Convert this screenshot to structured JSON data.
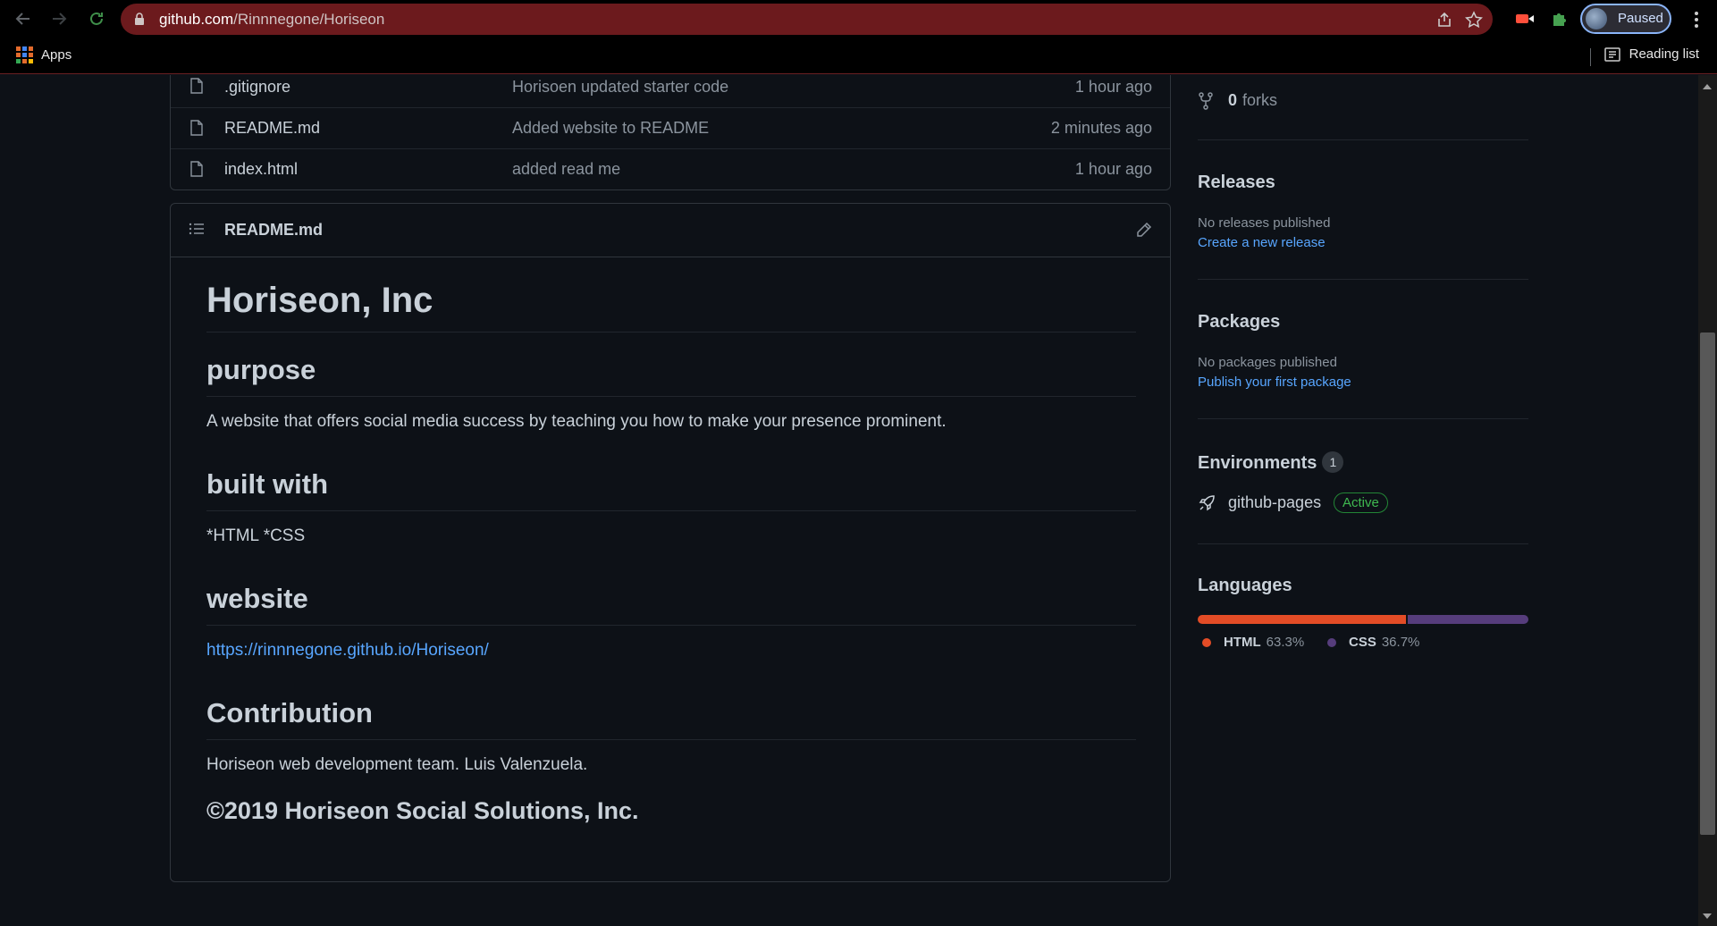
{
  "browser": {
    "url_host": "github.com",
    "url_path": "/Rinnnegone/Horiseon",
    "profile_label": "Paused",
    "apps_label": "Apps",
    "reading_list_label": "Reading list"
  },
  "files": [
    {
      "name": ".gitignore",
      "message": "Horisoen updated starter code",
      "age": "1 hour ago"
    },
    {
      "name": "README.md",
      "message": "Added website to README",
      "age": "2 minutes ago"
    },
    {
      "name": "index.html",
      "message": "added read me",
      "age": "1 hour ago"
    }
  ],
  "readme": {
    "header_title": "README.md",
    "h1": "Horiseon, Inc",
    "sections": {
      "purpose_heading": "purpose",
      "purpose_text": "A website that offers social media success by teaching you how to make your presence prominent.",
      "built_heading": "built with",
      "built_text": "*HTML *CSS",
      "website_heading": "website",
      "website_link": "https://rinnnegone.github.io/Horiseon/",
      "contribution_heading": "Contribution",
      "contribution_text": "Horiseon web development team. Luis Valenzuela.",
      "copyright": "©2019 Horiseon Social Solutions, Inc."
    }
  },
  "sidebar": {
    "forks_count": "0",
    "forks_label": "forks",
    "releases": {
      "heading": "Releases",
      "empty": "No releases published",
      "link": "Create a new release"
    },
    "packages": {
      "heading": "Packages",
      "empty": "No packages published",
      "link": "Publish your first package"
    },
    "environments": {
      "heading": "Environments",
      "count": "1",
      "name": "github-pages",
      "status": "Active"
    },
    "languages": {
      "heading": "Languages",
      "items": [
        {
          "name": "HTML",
          "percent": "63.3%",
          "value": 63.3,
          "color": "#e34c26"
        },
        {
          "name": "CSS",
          "percent": "36.7%",
          "value": 36.7,
          "color": "#563d7c"
        }
      ]
    }
  }
}
